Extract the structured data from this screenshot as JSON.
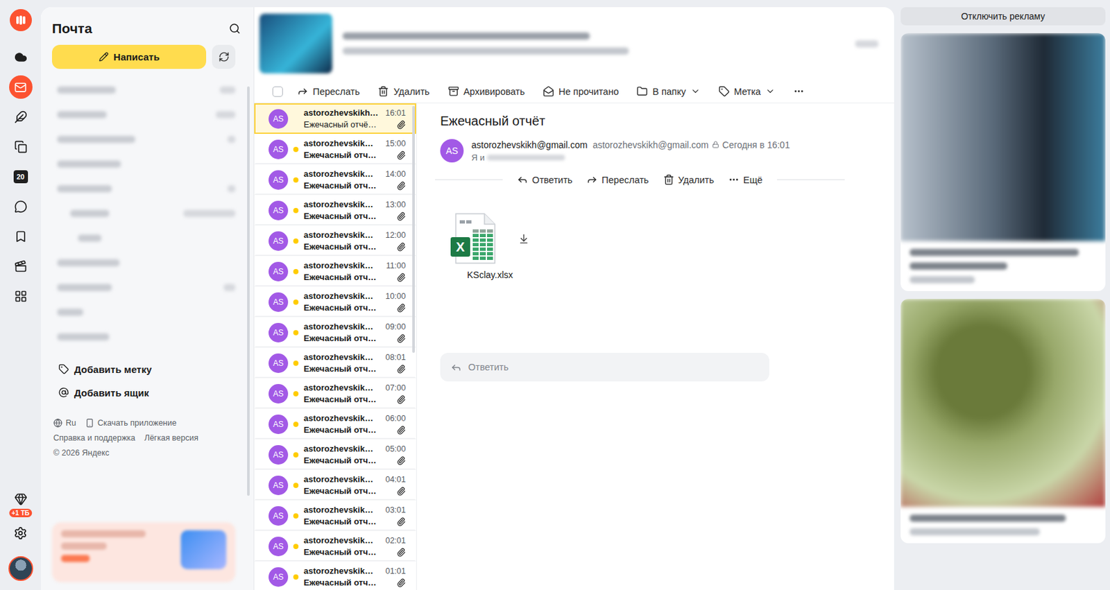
{
  "app": {
    "title": "Почта",
    "compose": "Написать"
  },
  "rail": {
    "calendar_day": "20",
    "storage_badge": "+1 ТБ"
  },
  "sidebar": {
    "actions": [
      "Добавить метку",
      "Добавить ящик"
    ],
    "footer": {
      "language": "Ru",
      "download": "Скачать приложение",
      "links": [
        "Справка и поддержка",
        "Лёгкая версия"
      ],
      "copyright": "© 2026 Яндекс"
    }
  },
  "toolbar": {
    "select_all": false,
    "buttons": [
      {
        "label": "Переслать",
        "kind": "forward"
      },
      {
        "label": "Удалить",
        "kind": "delete"
      },
      {
        "label": "Архивировать",
        "kind": "archive"
      },
      {
        "label": "Не прочитано",
        "kind": "unread"
      },
      {
        "label": "В папку",
        "kind": "folder"
      },
      {
        "label": "Метка",
        "kind": "tag"
      },
      {
        "label": "",
        "kind": "more"
      }
    ]
  },
  "messages": [
    {
      "avatar": "AS",
      "sender": "astorozhevskikh…",
      "subject": "Ежечасный отчё…",
      "time": "16:01",
      "unread": false,
      "selected": true,
      "has_attachment": true
    },
    {
      "avatar": "AS",
      "sender": "astorozhevskik…",
      "subject": "Ежечасный отч…",
      "time": "15:00",
      "unread": true,
      "selected": false,
      "has_attachment": true
    },
    {
      "avatar": "AS",
      "sender": "astorozhevskik…",
      "subject": "Ежечасный отч…",
      "time": "14:00",
      "unread": true,
      "selected": false,
      "has_attachment": true
    },
    {
      "avatar": "AS",
      "sender": "astorozhevskik…",
      "subject": "Ежечасный отч…",
      "time": "13:00",
      "unread": true,
      "selected": false,
      "has_attachment": true
    },
    {
      "avatar": "AS",
      "sender": "astorozhevskik…",
      "subject": "Ежечасный отч…",
      "time": "12:00",
      "unread": true,
      "selected": false,
      "has_attachment": true
    },
    {
      "avatar": "AS",
      "sender": "astorozhevskik…",
      "subject": "Ежечасный отч…",
      "time": "11:00",
      "unread": true,
      "selected": false,
      "has_attachment": true
    },
    {
      "avatar": "AS",
      "sender": "astorozhevskik…",
      "subject": "Ежечасный отч…",
      "time": "10:00",
      "unread": true,
      "selected": false,
      "has_attachment": true
    },
    {
      "avatar": "AS",
      "sender": "astorozhevskik…",
      "subject": "Ежечасный отч…",
      "time": "09:00",
      "unread": true,
      "selected": false,
      "has_attachment": true
    },
    {
      "avatar": "AS",
      "sender": "astorozhevskik…",
      "subject": "Ежечасный отч…",
      "time": "08:01",
      "unread": true,
      "selected": false,
      "has_attachment": true
    },
    {
      "avatar": "AS",
      "sender": "astorozhevskik…",
      "subject": "Ежечасный отч…",
      "time": "07:00",
      "unread": true,
      "selected": false,
      "has_attachment": true
    },
    {
      "avatar": "AS",
      "sender": "astorozhevskik…",
      "subject": "Ежечасный отч…",
      "time": "06:00",
      "unread": true,
      "selected": false,
      "has_attachment": true
    },
    {
      "avatar": "AS",
      "sender": "astorozhevskik…",
      "subject": "Ежечасный отч…",
      "time": "05:00",
      "unread": true,
      "selected": false,
      "has_attachment": true
    },
    {
      "avatar": "AS",
      "sender": "astorozhevskik…",
      "subject": "Ежечасный отч…",
      "time": "04:01",
      "unread": true,
      "selected": false,
      "has_attachment": true
    },
    {
      "avatar": "AS",
      "sender": "astorozhevskik…",
      "subject": "Ежечасный отч…",
      "time": "03:01",
      "unread": true,
      "selected": false,
      "has_attachment": true
    },
    {
      "avatar": "AS",
      "sender": "astorozhevskik…",
      "subject": "Ежечасный отч…",
      "time": "02:01",
      "unread": true,
      "selected": false,
      "has_attachment": true
    },
    {
      "avatar": "AS",
      "sender": "astorozhevskik…",
      "subject": "Ежечасный отч…",
      "time": "01:01",
      "unread": true,
      "selected": false,
      "has_attachment": true
    }
  ],
  "message": {
    "subject": "Ежечасный отчёт",
    "avatar": "AS",
    "from_name": "astorozhevskikh@gmail.com",
    "from_email": "astorozhevskikh@gmail.com",
    "date": "Сегодня в 16:01",
    "to": "Я и",
    "actions": [
      {
        "label": "Ответить",
        "kind": "reply"
      },
      {
        "label": "Переслать",
        "kind": "forward"
      },
      {
        "label": "Удалить",
        "kind": "delete"
      },
      {
        "label": "Ещё",
        "kind": "more"
      }
    ],
    "attachments": [
      {
        "name": "KSclay.xlsx",
        "badge": "X"
      }
    ],
    "reply_placeholder": "Ответить"
  },
  "ads": {
    "disable": "Отключить рекламу"
  }
}
